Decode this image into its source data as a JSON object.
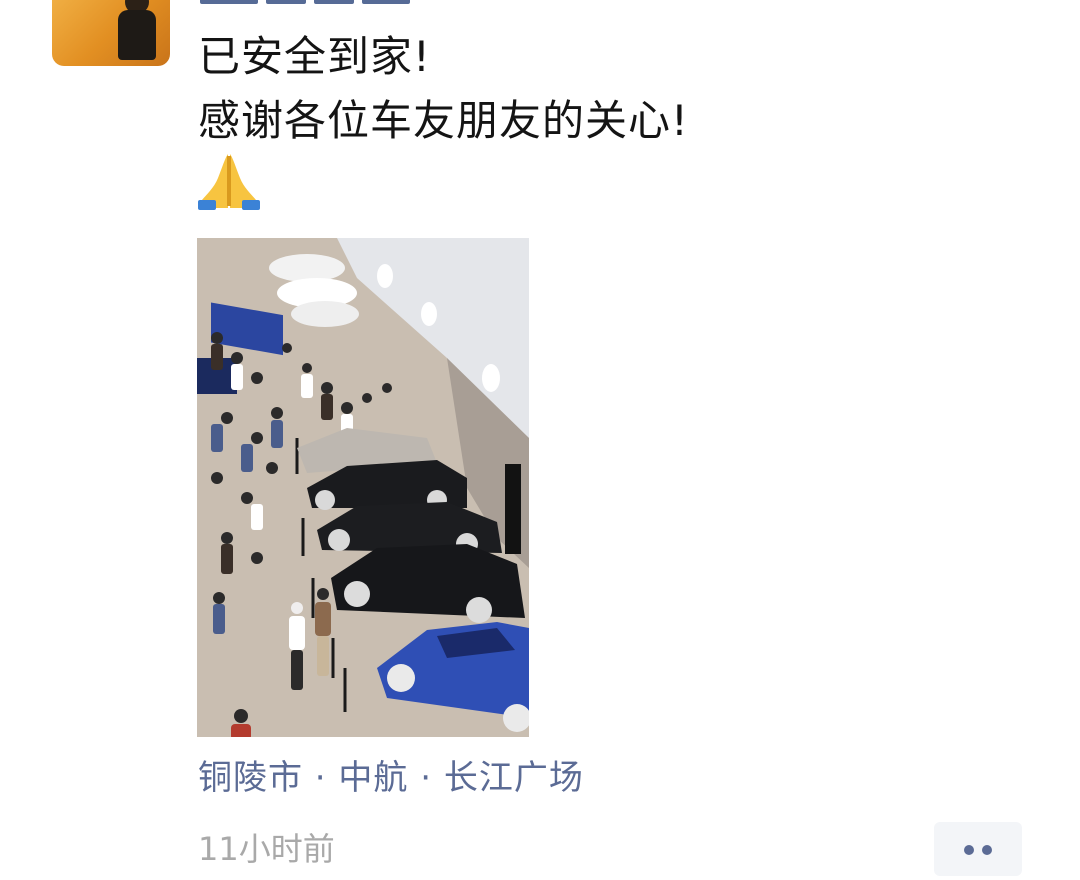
{
  "post": {
    "text_lines": [
      "已安全到家!",
      "感谢各位车友朋友的关心!"
    ],
    "emoji": "🙏",
    "emoji_name": "folded-hands",
    "photo": {
      "description_icon": "car-show-photo",
      "colors": {
        "floor": "#c9beb1",
        "wall": "#e6e8ec",
        "blue_car": "#2f4fb5",
        "dark_car": "#1a1b1e"
      }
    },
    "location": "铜陵市 · 中航 · 长江广场",
    "time": "11小时前"
  },
  "colors": {
    "link": "#5b6b95",
    "text": "#141414",
    "meta": "#a9a9a9",
    "avatar": "#e89a2c"
  }
}
